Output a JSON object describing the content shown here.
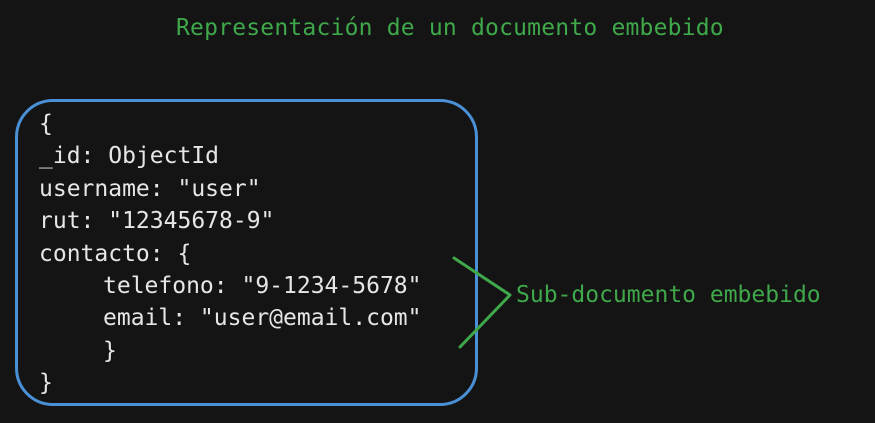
{
  "title": "Representación de un documento embebido",
  "document": {
    "lines": [
      "{",
      "_id: ObjectId",
      "username: \"user\"",
      "rut: \"12345678-9\"",
      "contacto: {",
      "telefono: \"9-1234-5678\"",
      "email: \"user@email.com\"",
      "}",
      "}"
    ]
  },
  "annotation": {
    "label": "Sub-documento embebido"
  },
  "colors": {
    "background": "#141414",
    "text": "#e6e6e6",
    "accent_green": "#3fa84a",
    "box_blue": "#4a90d6"
  }
}
